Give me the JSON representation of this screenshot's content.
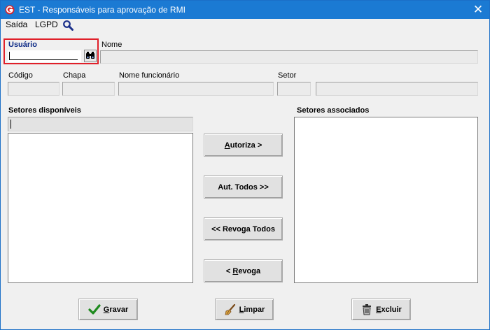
{
  "window": {
    "title": "EST - Responsáveis para aprovação de RMI",
    "close_glyph": "✕"
  },
  "menu": {
    "items": [
      "Saída",
      "LGPD"
    ],
    "search_icon": "search-icon"
  },
  "usuario": {
    "label": "Usuário",
    "value": ""
  },
  "nome": {
    "label": "Nome",
    "value": ""
  },
  "funcionario": {
    "codigo_label": "Código",
    "chapa_label": "Chapa",
    "nome_label": "Nome funcionário",
    "setor_label": "Setor"
  },
  "setores_disponiveis": {
    "label": "Setores disponíveis",
    "filter_value": "",
    "items": []
  },
  "setores_associados": {
    "label": "Setores associados",
    "items": []
  },
  "transfer_buttons": {
    "autoriza": {
      "u": "A",
      "rest": "utoriza >"
    },
    "aut_todos": {
      "u": "",
      "rest": "Aut. Todos >>"
    },
    "revoga_todos": {
      "u": "",
      "rest": "<< Revoga Todos"
    },
    "revoga": {
      "pre": "< ",
      "u": "R",
      "rest": "evoga"
    }
  },
  "footer_buttons": {
    "gravar": {
      "u": "G",
      "rest": "ravar"
    },
    "limpar": {
      "u": "L",
      "rest": "impar"
    },
    "excluir": {
      "u": "E",
      "rest": "xcluir"
    }
  },
  "colors": {
    "titlebar": "#1b7ad3",
    "highlight": "#e0202a",
    "label_accent": "#0c2a86"
  }
}
